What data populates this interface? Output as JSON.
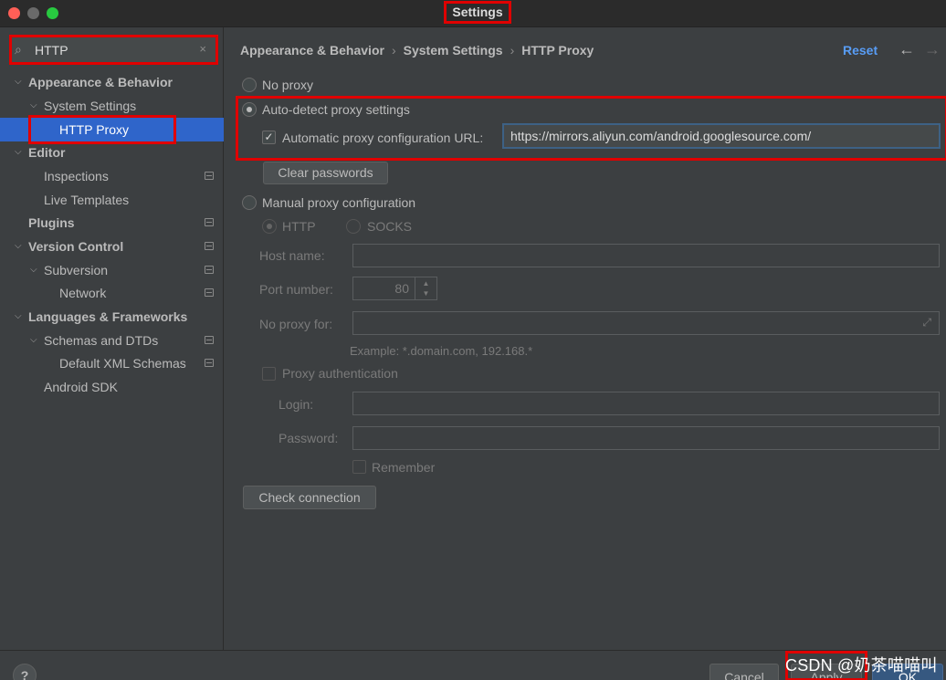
{
  "window": {
    "title": "Settings"
  },
  "search": {
    "value": "HTTP",
    "clear_symbol": "×"
  },
  "sidebar": {
    "items": [
      {
        "label": "Appearance & Behavior"
      },
      {
        "label": "System Settings"
      },
      {
        "label": "HTTP Proxy"
      },
      {
        "label": "Editor"
      },
      {
        "label": "Inspections"
      },
      {
        "label": "Live Templates"
      },
      {
        "label": "Plugins"
      },
      {
        "label": "Version Control"
      },
      {
        "label": "Subversion"
      },
      {
        "label": "Network"
      },
      {
        "label": "Languages & Frameworks"
      },
      {
        "label": "Schemas and DTDs"
      },
      {
        "label": "Default XML Schemas"
      },
      {
        "label": "Android SDK"
      }
    ]
  },
  "header": {
    "breadcrumb": [
      "Appearance & Behavior",
      "System Settings",
      "HTTP Proxy"
    ],
    "reset_label": "Reset"
  },
  "proxy": {
    "no_proxy_label": "No proxy",
    "auto_detect_label": "Auto-detect proxy settings",
    "auto_config_url_label": "Automatic proxy configuration URL:",
    "auto_config_url_value": "https://mirrors.aliyun.com/android.googlesource.com/",
    "clear_passwords_label": "Clear passwords",
    "manual_label": "Manual proxy configuration",
    "http_label": "HTTP",
    "socks_label": "SOCKS",
    "host_name_label": "Host name:",
    "port_number_label": "Port number:",
    "port_value": "80",
    "no_proxy_for_label": "No proxy for:",
    "example_text": "Example: *.domain.com, 192.168.*",
    "proxy_auth_label": "Proxy authentication",
    "login_label": "Login:",
    "password_label": "Password:",
    "remember_label": "Remember",
    "check_connection_label": "Check connection"
  },
  "footer": {
    "help_label": "?",
    "cancel_label": "Cancel",
    "apply_label": "Apply",
    "ok_label": "OK",
    "watermark": "CSDN @奶茶喵喵叫"
  },
  "colors": {
    "accent": "#2f65ca",
    "link": "#589df6",
    "highlight": "#e00000",
    "background": "#3c3f41"
  }
}
